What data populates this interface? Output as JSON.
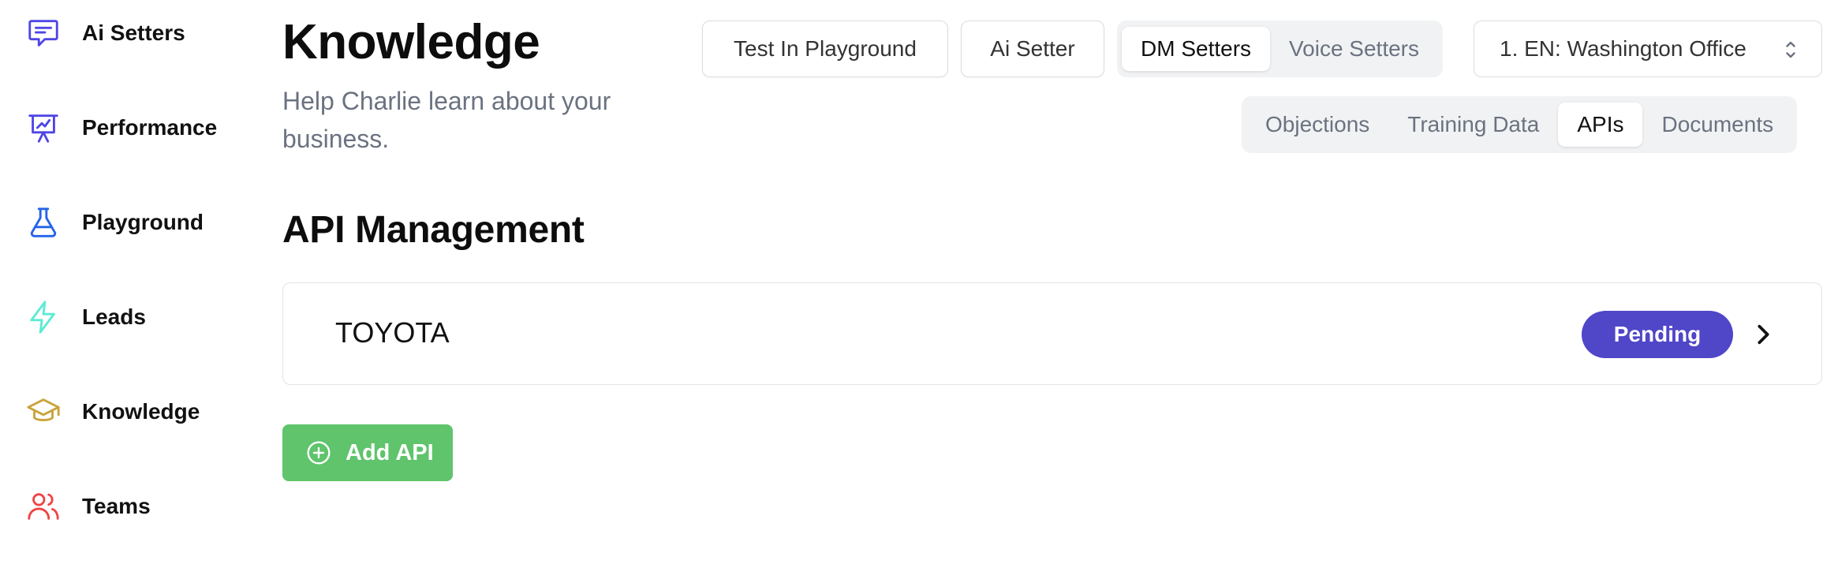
{
  "sidebar": {
    "items": [
      {
        "label": "Ai Setters",
        "icon": "chat-bubble-icon",
        "color": "#4f46e5"
      },
      {
        "label": "Performance",
        "icon": "presentation-chart-icon",
        "color": "#4f46e5"
      },
      {
        "label": "Playground",
        "icon": "beaker-icon",
        "color": "#2563eb"
      },
      {
        "label": "Leads",
        "icon": "lightning-bolt-icon",
        "color": "#5eead4"
      },
      {
        "label": "Knowledge",
        "icon": "graduation-cap-icon",
        "color": "#c9a43b"
      },
      {
        "label": "Teams",
        "icon": "users-icon",
        "color": "#ef4444"
      }
    ]
  },
  "header": {
    "title": "Knowledge",
    "subtitle": "Help Charlie learn about your business.",
    "test_playground_label": "Test In Playground",
    "ai_setter_label": "Ai Setter",
    "setter_types": [
      "DM Setters",
      "Voice Setters"
    ],
    "setter_type_active": "DM Setters",
    "office_select_value": "1. EN: Washington Office",
    "knowledge_tabs": [
      "Objections",
      "Training Data",
      "APIs",
      "Documents"
    ],
    "knowledge_tab_active": "APIs"
  },
  "main": {
    "section_title": "API Management",
    "apis": [
      {
        "name": "TOYOTA",
        "status": "Pending"
      }
    ],
    "add_button_label": "Add API"
  },
  "colors": {
    "badge_pending": "#5046c8",
    "add_button": "#5fc46c",
    "muted_text": "#6b7280"
  }
}
